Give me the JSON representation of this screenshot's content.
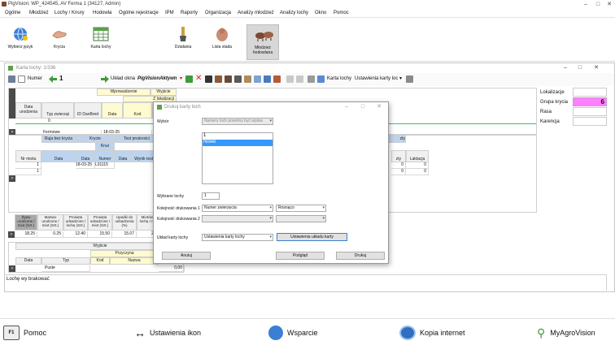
{
  "window": {
    "title": "PigVision: WP_424545, AV Ferma 1 (34127, Admin)"
  },
  "menu": [
    "Ogólne",
    "Młodzież",
    "Lochy / Knury",
    "Hodowla",
    "Ogólne rejestracje",
    "IPM",
    "Raporty",
    "Organizacja",
    "Analizy młodzież",
    "Analizy lochy",
    "Okno",
    "Pomoc"
  ],
  "ribbon": {
    "lang": "Wybierz język",
    "krycia": "Krycia",
    "karta": "Karta lochy",
    "dzialania": "Działania",
    "stado": "Lista stada",
    "mlodziez": "Młodzież hodowlana"
  },
  "child": {
    "title": "Karta lochy: 1/336",
    "numer_label": "Numer",
    "numer_value": "1",
    "uklad": "Układ okna",
    "layout_name": "PigVisionAktywn",
    "karta_label": "Karta lochy",
    "ustawienia_label": "Ustawienia karty loc"
  },
  "topgrid": {
    "wprowadzenie": "Wprowadzenie",
    "wyjscie": "Wyjście",
    "z_lokalizacji": "Z lokalizacji",
    "data_urodzenia": "Data urodzenia",
    "typ_zwierzat": "Typ zwierząt",
    "id_danbred": "ID DanBred",
    "data": "Data",
    "kod": "Kod",
    "row_zero": "0",
    "typ_value": "Fermowe",
    "date_value": "18-03-25"
  },
  "sidepanel": {
    "lokalizacje": "Lokalizacje",
    "grupa_krycia": "Grupa krycia",
    "grupa_value": "6",
    "rasa": "Rasa",
    "karencja": "Karencja"
  },
  "midgrid": {
    "ruja": "Ruja bez krycia",
    "krycie": "Krycie",
    "test": "Test prośności",
    "nr_miotu": "Nr miotu",
    "data": "Data",
    "knur": "Knur",
    "numer": "Numer",
    "wynik": "Wynik testu",
    "rows": [
      {
        "nr": "1",
        "data": "18-03-25",
        "numer": "L01115"
      },
      {
        "nr": "1",
        "data": "",
        "numer": ""
      }
    ],
    "right_hdr": "zty",
    "laktacja": "Laktacja",
    "right_vals": [
      "0",
      "0"
    ]
  },
  "stats": {
    "headers": [
      "Żywo urodzone / miot (Szt.)",
      "Martwo urodzone / miot (Szt.)",
      "Prosięta odsadzone / lochę (Szt.)",
      "Prosięta odsadzone / miot (Szt.)",
      "Upadki do odsadzenia (%)",
      "Miotów / lochę / rok"
    ],
    "values": [
      "18.25",
      "0.25",
      "12.40",
      "15.50",
      "15.07",
      "2.1"
    ]
  },
  "bottomgrid": {
    "wyjscie": "Wyjście",
    "przyczyna": "Przyczyna",
    "data": "Data",
    "typ": "Typ",
    "kod": "Kod",
    "nazwa": "Nazwa",
    "typ_value": "Puste",
    "total": "0,00"
  },
  "status": {
    "text": "Lochę wy brakować"
  },
  "dialog": {
    "title": "Drukuj karty loch",
    "wybor_label": "Wybór",
    "wybor_value": "Numery loch powinny być wpisw",
    "list_items": [
      "1",
      "Nowe"
    ],
    "wybrane_label": "Wybrane lochy",
    "wybrane_value": "1",
    "kol1_label": "Kolejność drukowania 1",
    "kol1_value": "Numer zwierzęcia",
    "kol1_order": "Rosnąco",
    "kol2_label": "Kolejność drukowania 2",
    "uklad_label": "Układ karty lochy",
    "uklad_value": "Ustawienia karty lochy",
    "btn_ustawienia": "Ustawienia układu karty",
    "btn_anuluj": "Anuluj",
    "btn_podglad": "Podgląd",
    "btn_drukuj": "Drukuj"
  },
  "footer": {
    "pomoc": "Pomoc",
    "f1": "F1",
    "ustawienia": "Ustawienia ikon",
    "wsparcie": "Wsparcie",
    "kopia": "Kopia internet",
    "agro": "MyAgroVision"
  },
  "colors": {
    "highlight": "#ff80ff",
    "selection": "#3399ff",
    "blue_header": "#bcd4f0",
    "yellow": "#fffbd0",
    "dark_cell": "#4a4a4a"
  }
}
